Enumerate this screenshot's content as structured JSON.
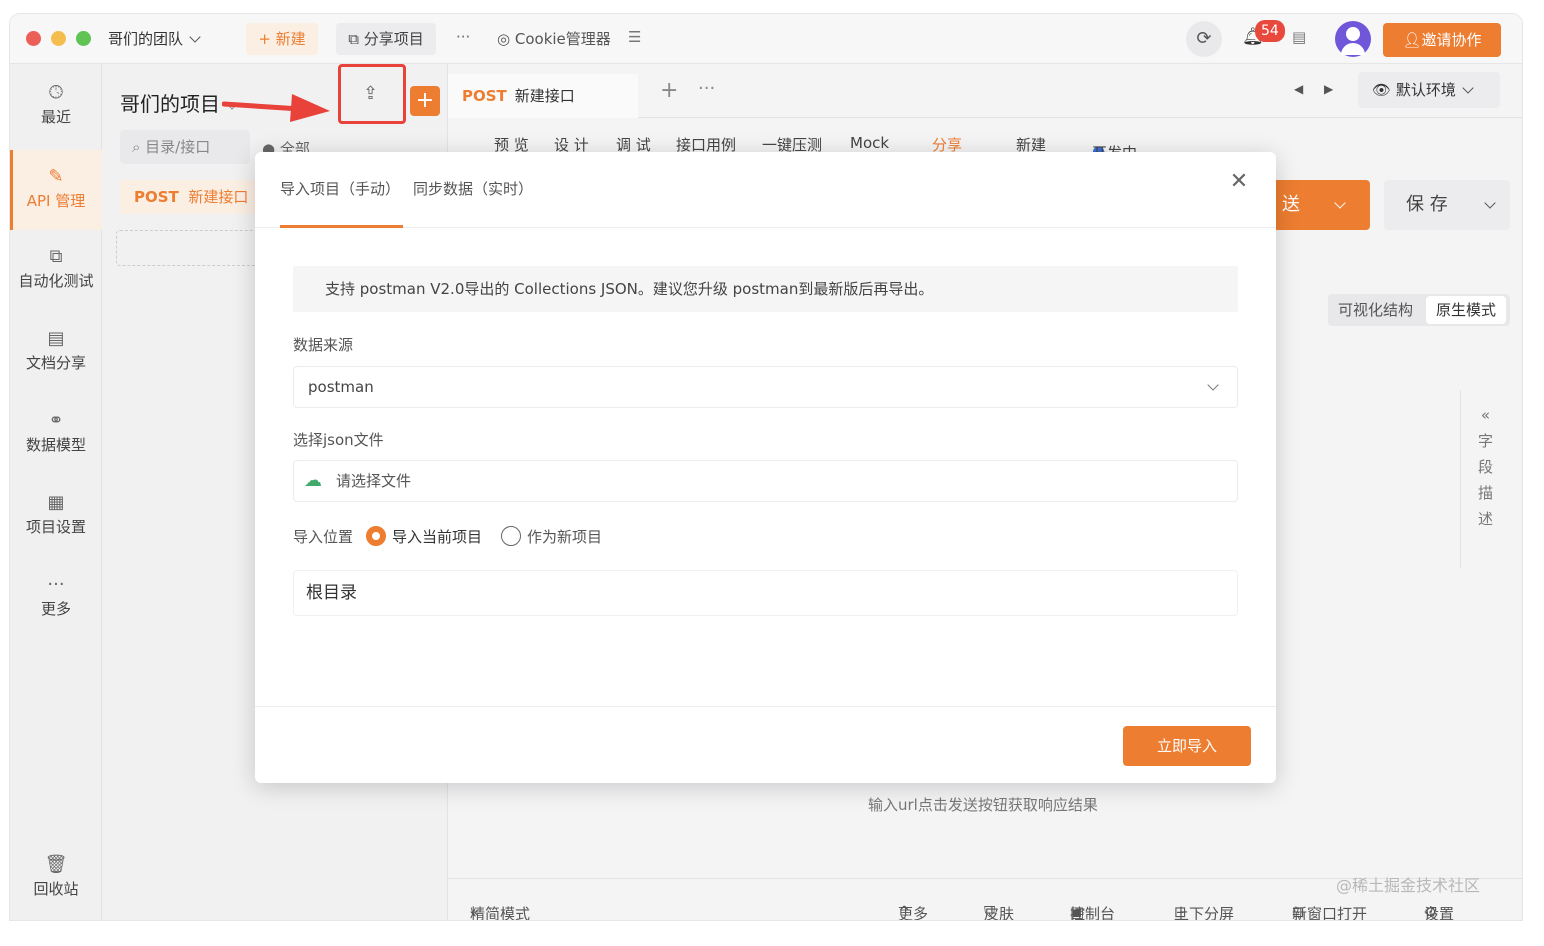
{
  "titlebar": {
    "team": "哥们的团队",
    "new_label": "+ 新建",
    "share_label": "分享项目",
    "more": "···",
    "cookie_label": "Cookie管理器",
    "notification_count": "54",
    "invite_label": "邀请协作"
  },
  "sidebar": {
    "items": [
      {
        "label": "最近",
        "icon": "clock-icon"
      },
      {
        "label": "API 管理",
        "icon": "edit-icon"
      },
      {
        "label": "自动化测试",
        "icon": "flow-icon"
      },
      {
        "label": "文档分享",
        "icon": "doc-icon"
      },
      {
        "label": "数据模型",
        "icon": "model-icon"
      },
      {
        "label": "项目设置",
        "icon": "settings-doc-icon"
      },
      {
        "label": "更多",
        "icon": "more-icon"
      },
      {
        "label": "回收站",
        "icon": "trash-icon"
      }
    ]
  },
  "project": {
    "title": "哥们的项目",
    "search_placeholder": "目录/接口",
    "filter": "全部",
    "api_method": "POST",
    "api_name": "新建接口"
  },
  "main": {
    "tab_method": "POST",
    "tab_name": "新建接口",
    "env": "默认环境",
    "sub_tabs": [
      "预 览",
      "设 计",
      "调 试",
      "接口用例",
      "一键压测",
      "Mock"
    ],
    "share": "分享",
    "new_label": "新建",
    "status": "开发中",
    "send": "送",
    "save": "保 存",
    "vis_structure": "可视化结构",
    "raw_mode": "原生模式",
    "field_desc": [
      "字",
      "段",
      "描",
      "述"
    ],
    "response_hint": "输入url点击发送按钮获取响应结果"
  },
  "bottombar": {
    "simple_mode": "精简模式",
    "more": "更多",
    "skin": "皮肤",
    "console": "控制台",
    "split": "上下分屏",
    "new_window": "新窗口打开",
    "settings": "设置",
    "watermark": "@稀土掘金技术社区"
  },
  "modal": {
    "tab_manual": "导入项目（手动）",
    "tab_sync": "同步数据（实时）",
    "info": "支持 postman V2.0导出的 Collections JSON。建议您升级 postman到最新版后再导出。",
    "source_label": "数据来源",
    "source_value": "postman",
    "file_label": "选择json文件",
    "file_placeholder": "请选择文件",
    "position_label": "导入位置",
    "option_current": "导入当前项目",
    "option_new": "作为新项目",
    "root": "根目录",
    "import_button": "立即导入"
  },
  "colors": {
    "accent": "#ed7d31",
    "highlight_red": "#e8423a",
    "success_green": "#42a96c"
  }
}
